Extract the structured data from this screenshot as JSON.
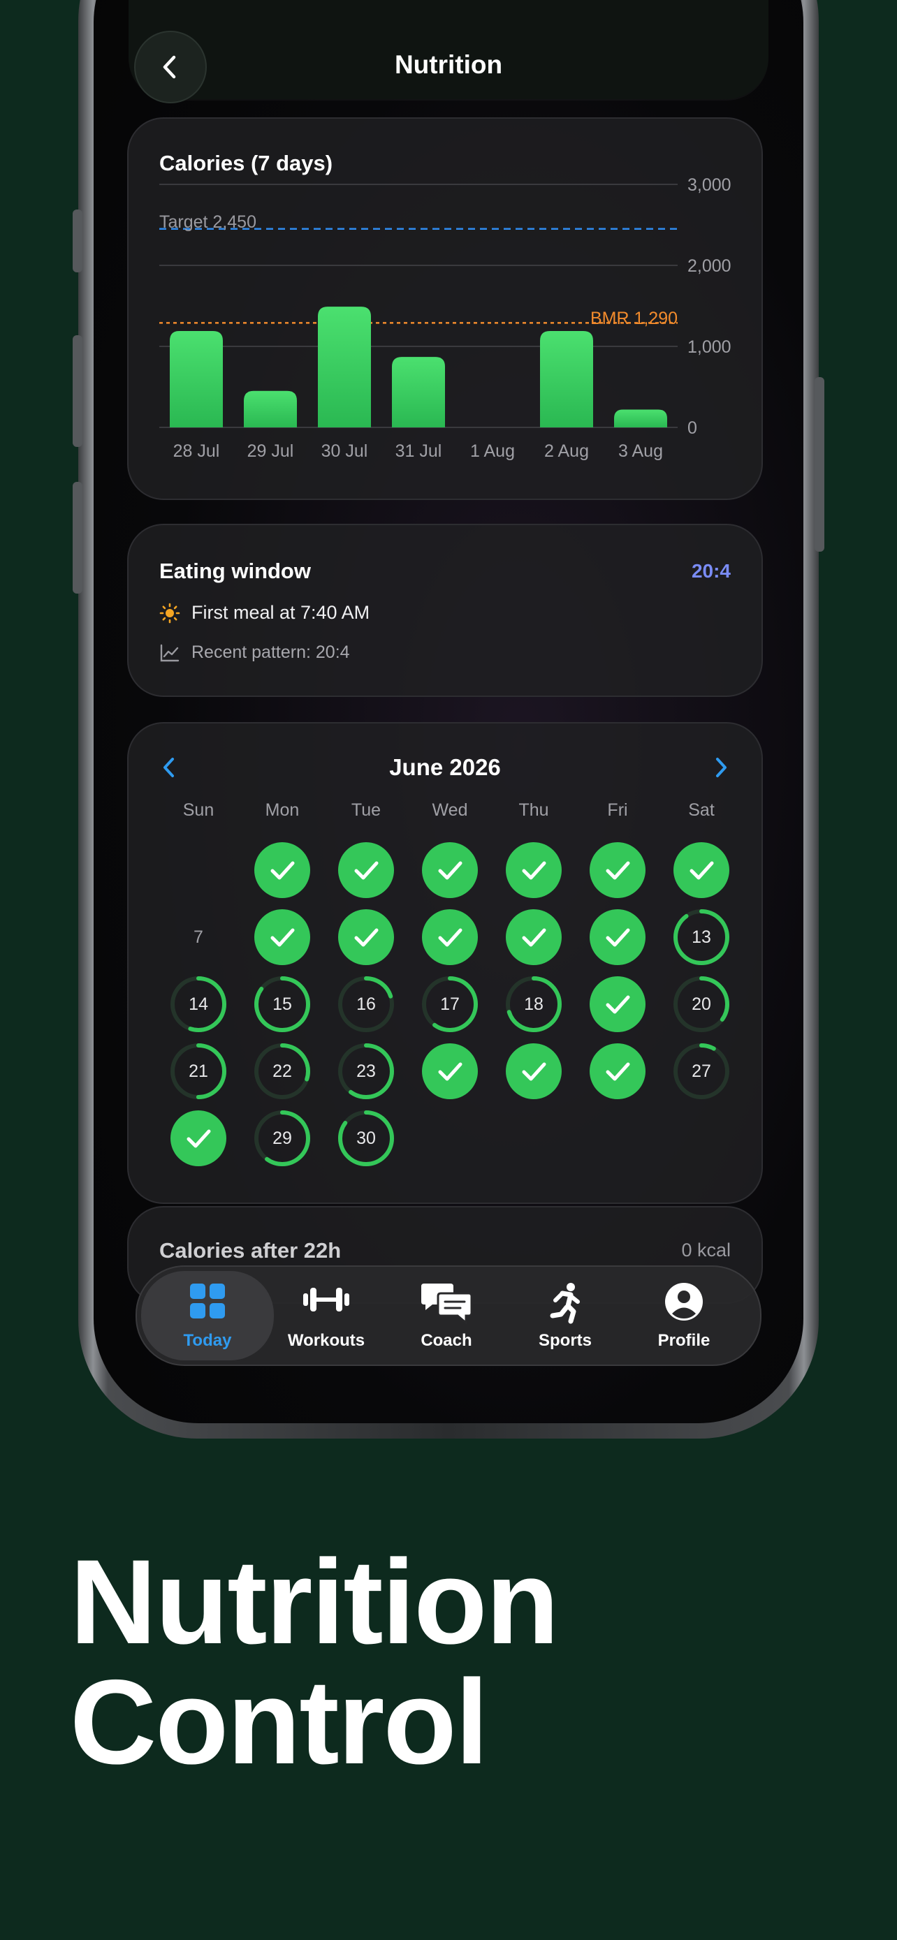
{
  "header": {
    "title": "Nutrition"
  },
  "calories_card": {
    "title": "Calories (7 days)",
    "target_label": "Target 2,450",
    "bmr_label": "BMR 1,290"
  },
  "chart_data": {
    "type": "bar",
    "title": "Calories (7 days)",
    "categories": [
      "28 Jul",
      "29 Jul",
      "30 Jul",
      "31 Jul",
      "1 Aug",
      "2 Aug",
      "3 Aug"
    ],
    "values": [
      1190,
      450,
      1490,
      870,
      0,
      1190,
      220
    ],
    "yticks": [
      "0",
      "1,000",
      "2,000",
      "3,000"
    ],
    "ylim": [
      0,
      3000
    ],
    "target": 2450,
    "bmr": 1290,
    "grid": true,
    "colors": {
      "bar": "#34c759",
      "target": "#2f8cf0",
      "bmr": "#f28b2c"
    }
  },
  "eating_window": {
    "title": "Eating window",
    "badge": "20:4",
    "first_meal": "First meal at 7:40 AM",
    "pattern": "Recent pattern: 20:4"
  },
  "calendar": {
    "month": "June 2026",
    "weekdays": [
      "Sun",
      "Mon",
      "Tue",
      "Wed",
      "Thu",
      "Fri",
      "Sat"
    ],
    "days": [
      {
        "d": "1",
        "done": true
      },
      {
        "d": "2",
        "done": true
      },
      {
        "d": "3",
        "done": true
      },
      {
        "d": "4",
        "done": true
      },
      {
        "d": "5",
        "done": true
      },
      {
        "d": "6",
        "done": true
      },
      {
        "d": "7",
        "plain": true
      },
      {
        "d": "8",
        "done": true
      },
      {
        "d": "9",
        "done": true
      },
      {
        "d": "10",
        "done": true
      },
      {
        "d": "11",
        "done": true
      },
      {
        "d": "12",
        "done": true
      },
      {
        "d": "13",
        "progress": 0.9
      },
      {
        "d": "14",
        "progress": 0.55
      },
      {
        "d": "15",
        "progress": 0.85
      },
      {
        "d": "16",
        "progress": 0.2
      },
      {
        "d": "17",
        "progress": 0.6
      },
      {
        "d": "18",
        "progress": 0.7
      },
      {
        "d": "19",
        "done": true
      },
      {
        "d": "20",
        "progress": 0.35
      },
      {
        "d": "21",
        "progress": 0.5
      },
      {
        "d": "22",
        "progress": 0.3
      },
      {
        "d": "23",
        "progress": 0.6
      },
      {
        "d": "24",
        "done": true
      },
      {
        "d": "25",
        "done": true
      },
      {
        "d": "26",
        "done": true
      },
      {
        "d": "27",
        "progress": 0.08
      },
      {
        "d": "28",
        "done": true
      },
      {
        "d": "29",
        "progress": 0.6
      },
      {
        "d": "30",
        "progress": 0.85
      }
    ]
  },
  "next_card": {
    "title": "Calories after 22h",
    "value": "0 kcal"
  },
  "tabbar": {
    "tabs": [
      {
        "label": "Today"
      },
      {
        "label": "Workouts"
      },
      {
        "label": "Coach"
      },
      {
        "label": "Sports"
      },
      {
        "label": "Profile"
      }
    ]
  },
  "headline": {
    "line1": "Nutrition",
    "line2": "Control"
  },
  "colors": {
    "accent_green": "#34c759",
    "accent_blue": "#2f9bf0",
    "badge_purple": "#7a8cf5"
  }
}
